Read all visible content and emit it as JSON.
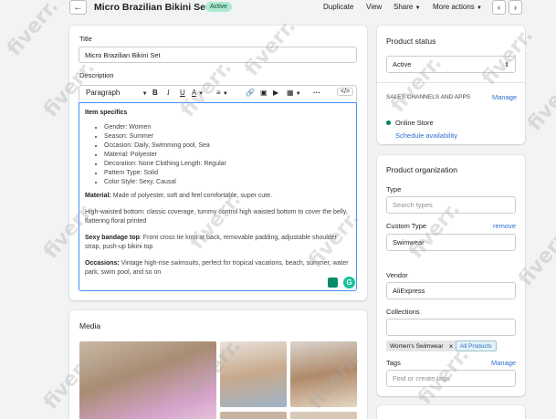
{
  "header": {
    "back_icon": "arrow-left-icon",
    "title": "Micro Brazilian Bikini Set",
    "status_badge": "Active",
    "actions": {
      "duplicate": "Duplicate",
      "view": "View",
      "share": "Share",
      "more_actions": "More actions"
    }
  },
  "product": {
    "title_label": "Title",
    "title_value": "Micro Brazilian Bikini Set",
    "description_label": "Description",
    "toolbar": {
      "format_select": "Paragraph",
      "bold": "B",
      "italic": "I",
      "underline": "U",
      "text_color": "A"
    },
    "description": {
      "item_specifics_heading": "Item specifics",
      "item_specifics": [
        "Gender: Women",
        "Season: Summer",
        "Occasion: Daily, Swimming pool, Sea",
        "Material: Polyester",
        "Decoration: None Clothing Length: Regular",
        "Pattern Type: Solid",
        "Color Style: Sexy, Causal"
      ],
      "material_label": "Material:",
      "material_text": " Made of polyester, soft and feel comfortable, super cute.",
      "bottom_text": "High-waisted bottom: classic coverage, tummy control high waisted bottom to cover the belly, flattering floral printed",
      "top_label": "Sexy bandage top",
      "top_text": ": Front cross tie knot at back, removable padding, adjustable shoulder strap, push-up bikini top",
      "occasions_label": "Occasions:",
      "occasions_text": " Vintage high-rise swimsuits, perfect for tropical vacations, beach, summer, water park, swim pool, and so on"
    }
  },
  "media": {
    "heading": "Media"
  },
  "status_card": {
    "heading": "Product status",
    "status_value": "Active",
    "sales_channels_label": "SALES CHANNELS AND APPS",
    "manage_link": "Manage",
    "channel_name": "Online Store",
    "schedule_link": "Schedule availability"
  },
  "organization": {
    "heading": "Product organization",
    "type_label": "Type",
    "type_placeholder": "Search types",
    "custom_type_label": "Custom Type",
    "remove_link": "remove",
    "custom_type_value": "Swimwear",
    "vendor_label": "Vendor",
    "vendor_value": "AliExpress",
    "collections_label": "Collections",
    "collection_tag": "Women's Swimwear",
    "all_products_tag": "All Products",
    "tags_label": "Tags",
    "tags_manage_link": "Manage",
    "tags_placeholder": "Find or create tags"
  },
  "watermark": "fiverr.",
  "colors": {
    "accent": "#2c6ecb",
    "badge_bg": "#aee9d1",
    "online_dot": "#007f5f",
    "focus_border": "#458fff"
  }
}
